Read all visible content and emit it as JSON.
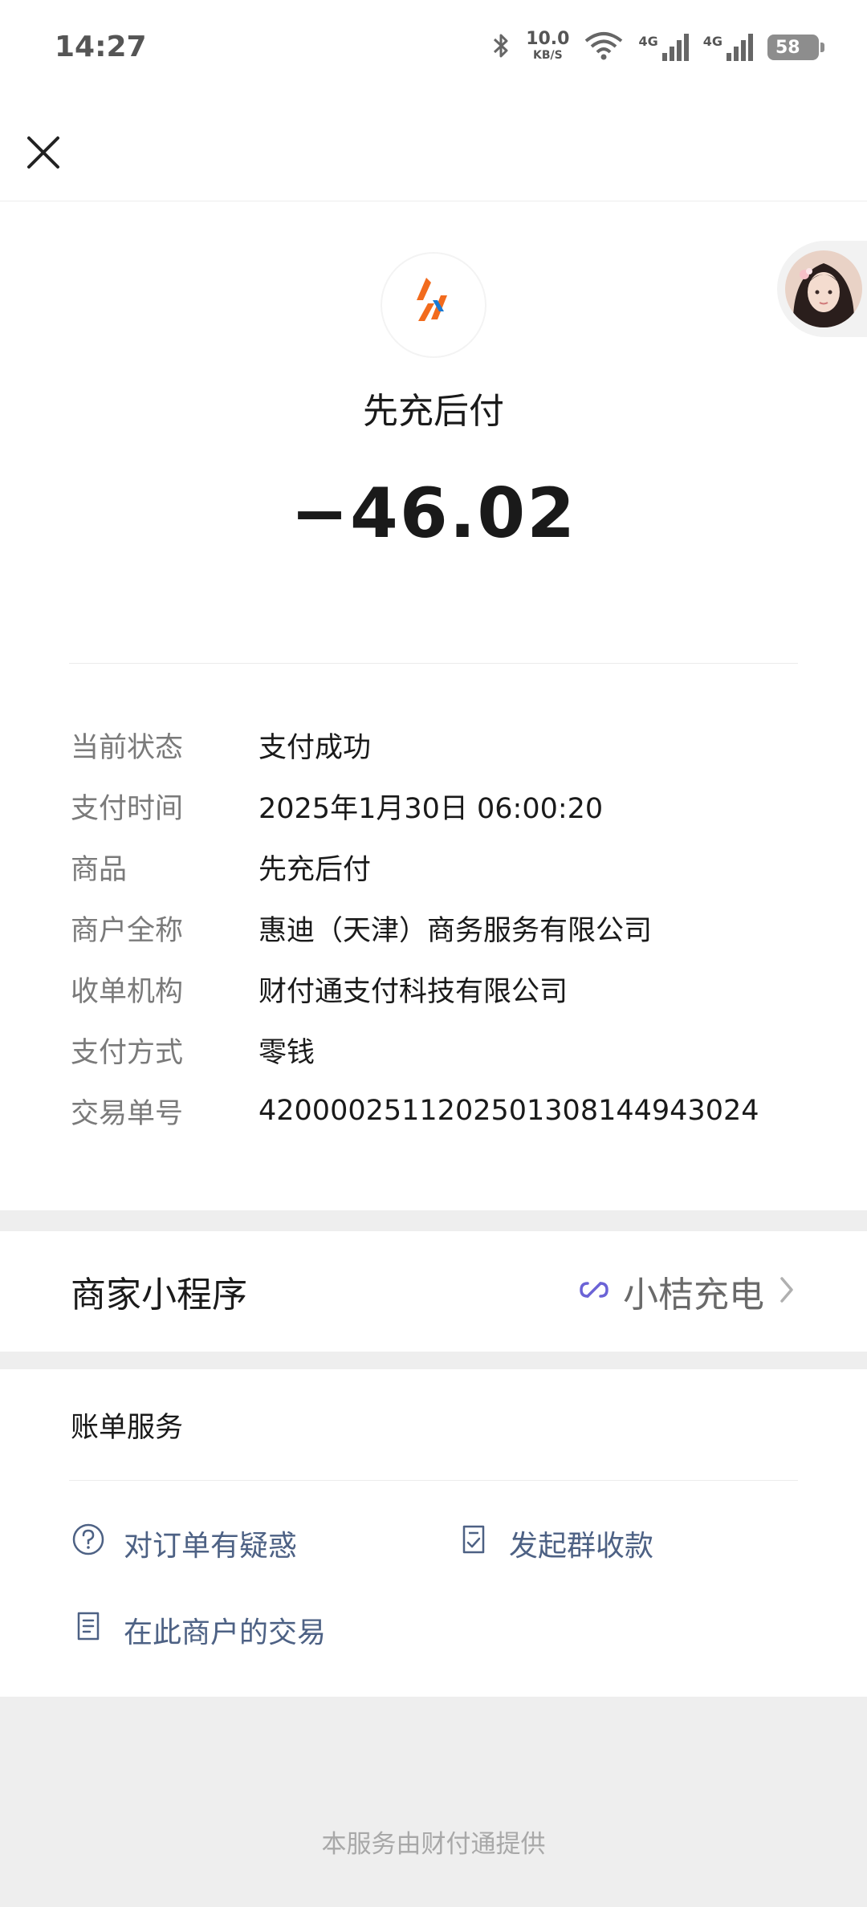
{
  "status_bar": {
    "time": "14:27",
    "net_speed": "10.0",
    "net_speed_unit": "KB/S",
    "sim1": "4G",
    "sim2": "4G",
    "battery": "58"
  },
  "icons": {
    "close": "close-icon",
    "bluetooth": "bluetooth-icon",
    "wifi": "wifi-icon",
    "link": "link-icon",
    "chevron": "chevron-right-icon",
    "question": "question-circle-icon",
    "group_collect": "bill-check-icon",
    "transactions": "document-icon"
  },
  "colors": {
    "link_text": "#4d6184",
    "logo_orange": "#f26b1d",
    "mini_link_icon": "#6b63d6"
  },
  "merchant": {
    "name": "先充后付",
    "amount": "−46.02"
  },
  "details": [
    {
      "label": "当前状态",
      "value": "支付成功"
    },
    {
      "label": "支付时间",
      "value": "2025年1月30日 06:00:20"
    },
    {
      "label": "商品",
      "value": "先充后付"
    },
    {
      "label": "商户全称",
      "value": "惠迪（天津）商务服务有限公司"
    },
    {
      "label": "收单机构",
      "value": "财付通支付科技有限公司"
    },
    {
      "label": "支付方式",
      "value": "零钱"
    },
    {
      "label": "交易单号",
      "value": "4200002511202501308144943024"
    }
  ],
  "mini_program": {
    "label": "商家小程序",
    "name": "小桔充电"
  },
  "bill_service": {
    "title": "账单服务",
    "items": [
      {
        "label": "对订单有疑惑"
      },
      {
        "label": "发起群收款"
      },
      {
        "label": "在此商户的交易"
      }
    ]
  },
  "footer": {
    "text": "本服务由财付通提供"
  }
}
